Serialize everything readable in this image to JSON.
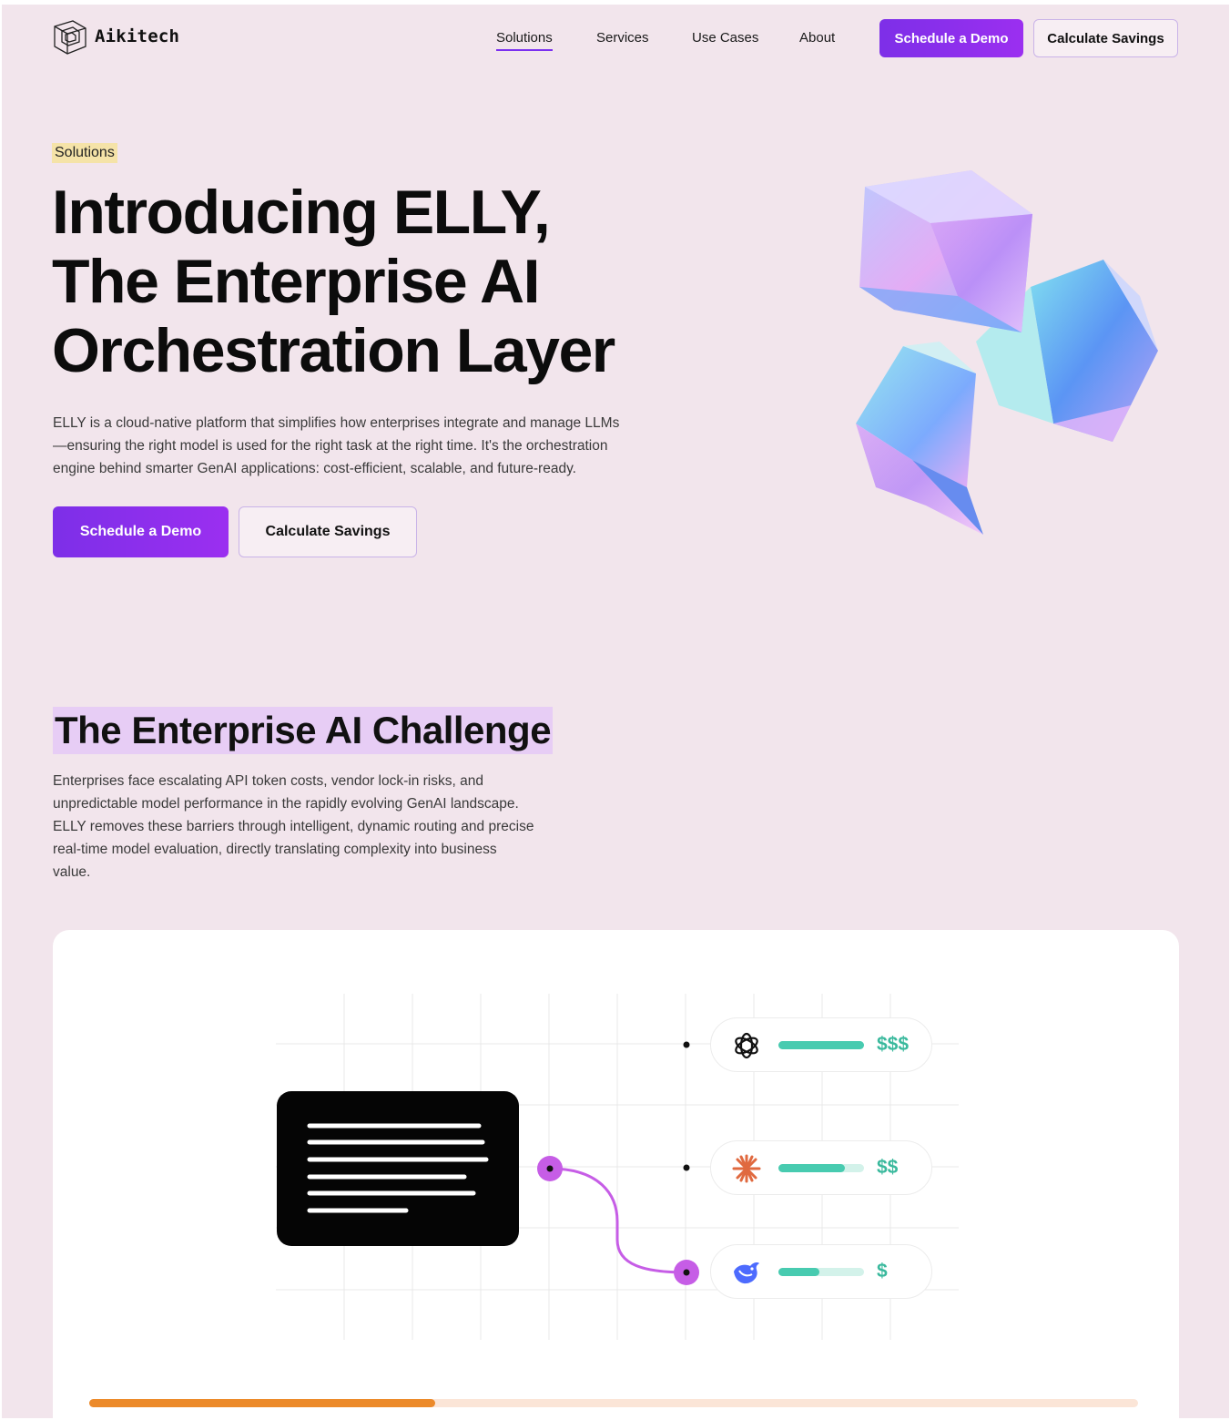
{
  "brand": {
    "name": "Aikitech"
  },
  "nav": {
    "links": [
      "Solutions",
      "Services",
      "Use Cases",
      "About"
    ],
    "active_index": 0,
    "primary_cta": "Schedule a Demo",
    "secondary_cta": "Calculate Savings"
  },
  "hero": {
    "tag": "Solutions",
    "title_lines": [
      "Introducing ELLY,",
      "The Enterprise AI",
      "Orchestration Layer"
    ],
    "description_lines": [
      "ELLY is a cloud-native platform that simplifies how enterprises integrate and manage LLMs",
      "—ensuring the right model is used for the right task at the right time. It's the orchestration",
      "engine behind smarter GenAI applications: cost-efficient, scalable, and future-ready."
    ],
    "primary_cta": "Schedule a Demo",
    "secondary_cta": "Calculate Savings"
  },
  "challenge": {
    "title": "The Enterprise AI Challenge",
    "description_lines": [
      "Enterprises face escalating API token costs, vendor lock-in risks, and",
      "unpredictable model performance in the rapidly evolving GenAI landscape.",
      "ELLY removes these barriers through intelligent, dynamic routing and precise",
      "real-time model evaluation, directly translating complexity into business",
      "value."
    ]
  },
  "diagram": {
    "models": [
      {
        "icon": "openai-icon",
        "cost": "$$$",
        "fill": 1.0
      },
      {
        "icon": "anthropic-icon",
        "cost": "$$",
        "fill": 0.78
      },
      {
        "icon": "deepseek-icon",
        "cost": "$",
        "fill": 0.48
      }
    ],
    "selected_model_index": 2,
    "progress": 0.33
  },
  "colors": {
    "page_bg": "#f2e5ec",
    "accent_purple": "#8a2ff0",
    "route_purple": "#c65de6",
    "teal": "#48cbb0",
    "orange": "#ec8a2a",
    "tag_yellow": "#f5e3a8",
    "title_highlight": "#e7cdf5"
  }
}
